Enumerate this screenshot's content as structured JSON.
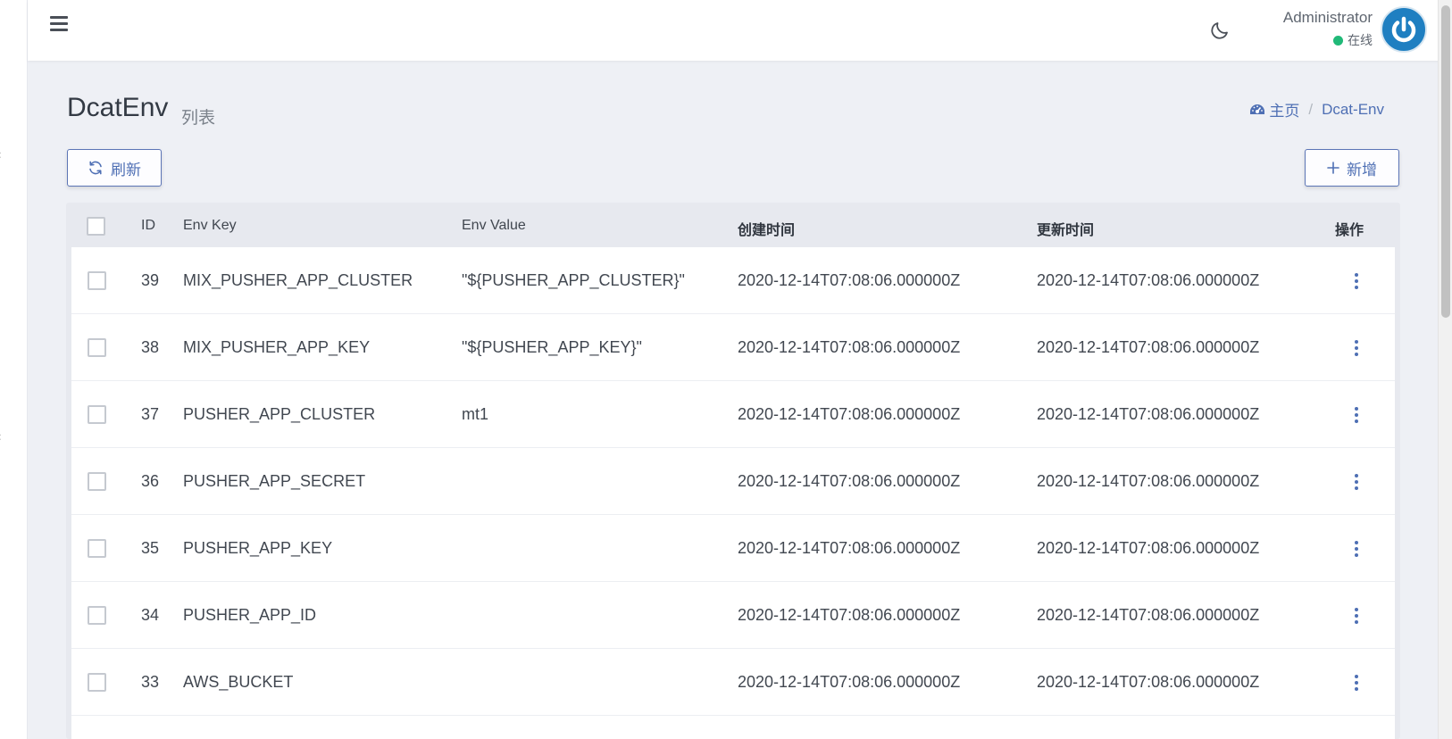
{
  "navbar": {
    "user_name": "Administrator",
    "user_status": "在线",
    "status_color": "#21b978",
    "avatar_color": "#1f7fc1"
  },
  "page": {
    "title": "DcatEnv",
    "subtitle": "列表"
  },
  "breadcrumb": {
    "home_label": "主页",
    "separator": "/",
    "current": "Dcat-Env"
  },
  "toolbar": {
    "refresh_label": "刷新",
    "new_label": "新增",
    "accent_color": "#4e6fb4"
  },
  "table": {
    "columns": {
      "id": "ID",
      "env_key": "Env Key",
      "env_value": "Env Value",
      "created_at": "创建时间",
      "updated_at": "更新时间",
      "actions": "操作"
    },
    "rows": [
      {
        "id": "39",
        "env_key": "MIX_PUSHER_APP_CLUSTER",
        "env_value": "\"${PUSHER_APP_CLUSTER}\"",
        "created_at": "2020-12-14T07:08:06.000000Z",
        "updated_at": "2020-12-14T07:08:06.000000Z"
      },
      {
        "id": "38",
        "env_key": "MIX_PUSHER_APP_KEY",
        "env_value": "\"${PUSHER_APP_KEY}\"",
        "created_at": "2020-12-14T07:08:06.000000Z",
        "updated_at": "2020-12-14T07:08:06.000000Z"
      },
      {
        "id": "37",
        "env_key": "PUSHER_APP_CLUSTER",
        "env_value": "mt1",
        "created_at": "2020-12-14T07:08:06.000000Z",
        "updated_at": "2020-12-14T07:08:06.000000Z"
      },
      {
        "id": "36",
        "env_key": "PUSHER_APP_SECRET",
        "env_value": "",
        "created_at": "2020-12-14T07:08:06.000000Z",
        "updated_at": "2020-12-14T07:08:06.000000Z"
      },
      {
        "id": "35",
        "env_key": "PUSHER_APP_KEY",
        "env_value": "",
        "created_at": "2020-12-14T07:08:06.000000Z",
        "updated_at": "2020-12-14T07:08:06.000000Z"
      },
      {
        "id": "34",
        "env_key": "PUSHER_APP_ID",
        "env_value": "",
        "created_at": "2020-12-14T07:08:06.000000Z",
        "updated_at": "2020-12-14T07:08:06.000000Z"
      },
      {
        "id": "33",
        "env_key": "AWS_BUCKET",
        "env_value": "",
        "created_at": "2020-12-14T07:08:06.000000Z",
        "updated_at": "2020-12-14T07:08:06.000000Z"
      }
    ]
  }
}
